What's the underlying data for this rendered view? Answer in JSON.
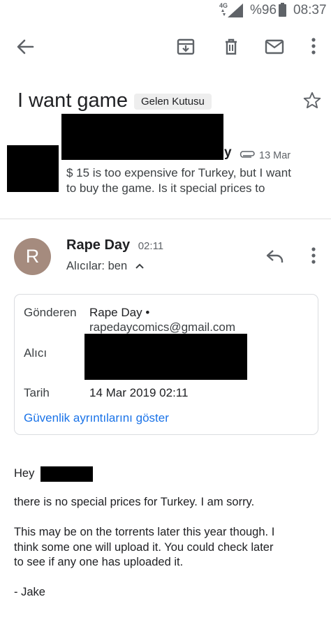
{
  "status_bar": {
    "network": "4G",
    "battery": "%96",
    "time": "08:37"
  },
  "toolbar": {
    "back": "back-arrow-icon",
    "archive": "archive-icon",
    "delete": "trash-icon",
    "mark_unread": "mail-icon",
    "more": "more-vert-icon"
  },
  "subject": {
    "title": "I want game",
    "label_chip": "Gelen Kutusu",
    "star": "star-outline-icon"
  },
  "previous_message": {
    "sender_tail": "y",
    "attachment_icon": "attachment-icon",
    "date": "13 Mar",
    "snippet_line1": "$ 15 is too expensive for Turkey, but I want",
    "snippet_line2": "to buy the game. Is it special prices to"
  },
  "message": {
    "avatar_letter": "R",
    "avatar_color": "#a58b7e",
    "sender": "Rape Day",
    "time": "02:11",
    "recipients": "Alıcılar: ben",
    "reply_icon": "reply-icon",
    "more_icon": "more-vert-icon"
  },
  "details": {
    "from_label": "Gönderen",
    "from_name": "Rape Day •",
    "from_email": "rapedaycomics@gmail.com",
    "to_label": "Alıcı",
    "date_label": "Tarih",
    "date_value": "14 Mar 2019 02:11",
    "security_link": "Güvenlik ayrıntılarını göster"
  },
  "body": {
    "greeting": "Hey",
    "line1": "there is no special prices for Turkey.  I am sorry.",
    "para2_line1": "This may be on the torrents later this year though.  I",
    "para2_line2": "think some one will upload it.  You could check later",
    "para2_line3": "to see if any one has uploaded it.",
    "signature": "- Jake"
  }
}
